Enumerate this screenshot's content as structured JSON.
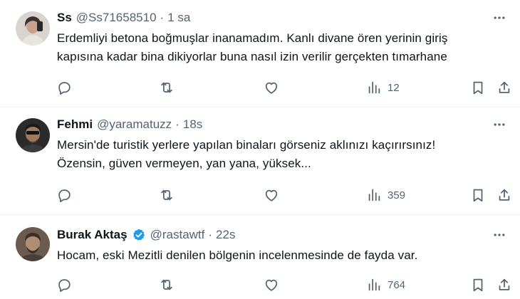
{
  "tweets": [
    {
      "name": "Ss",
      "handle": "@Ss71658510",
      "separator": "·",
      "time": "1 sa",
      "verified": false,
      "text_lines": [
        "Erdemliyi betona boğmuşlar inanamadım. Kanlı divane ören yerinin giriş",
        "kapısına kadar bina dikiyorlar buna nasıl izin verilir gerçekten tımarhane"
      ],
      "views": "12",
      "avatar_colors": [
        "#d9d4cf",
        "#3a3230",
        "#c9a08a"
      ]
    },
    {
      "name": "Fehmi",
      "handle": "@yaramatuzz",
      "separator": "·",
      "time": "18s",
      "verified": false,
      "text_lines": [
        "Mersin'de turistik yerlere yapılan binaları görseniz aklınızı kaçırırsınız!",
        "Özensin, güven vermeyen, yan yana, yüksek..."
      ],
      "views": "359",
      "avatar_colors": [
        "#2b2b2b",
        "#5a4638",
        "#a07a5e"
      ]
    },
    {
      "name": "Burak Aktaş",
      "handle": "@rastawtf",
      "separator": "·",
      "time": "22s",
      "verified": true,
      "text_lines": [
        "Hocam, eski Mezitli denilen bölgenin incelenmesinde de fayda var."
      ],
      "views": "764",
      "avatar_colors": [
        "#6b5b4e",
        "#3d2f26",
        "#b08e72"
      ]
    }
  ],
  "colors": {
    "text": "#0f1419",
    "secondary": "#536471",
    "divider": "#eff3f4",
    "verified": "#1d9bf0"
  },
  "icons": [
    "more-icon",
    "reply-icon",
    "retweet-icon",
    "like-icon",
    "views-icon",
    "bookmark-icon",
    "share-icon",
    "verified-badge-icon"
  ]
}
